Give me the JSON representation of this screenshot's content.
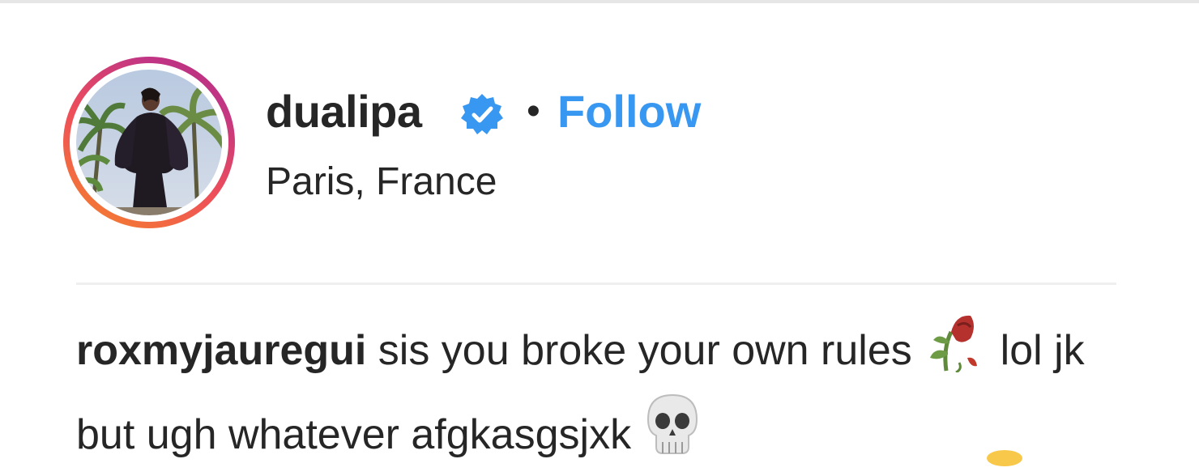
{
  "post_header": {
    "username": "dualipa",
    "verified": true,
    "separator": "•",
    "follow_label": "Follow",
    "location": "Paris, France",
    "avatar_ring_colors": [
      "#f58529",
      "#ee4e5a",
      "#c13584"
    ]
  },
  "comment": {
    "author": "roxmyjauregui",
    "text_part1": " sis you broke your own rules ",
    "emoji_1": "wilted-rose",
    "text_part2": " lol jk but ugh whatever afgkasgsjxk ",
    "emoji_2": "skull"
  },
  "colors": {
    "link_blue": "#3897f0",
    "text": "#262626",
    "verified_badge": "#3897f0",
    "divider": "#efefef"
  }
}
